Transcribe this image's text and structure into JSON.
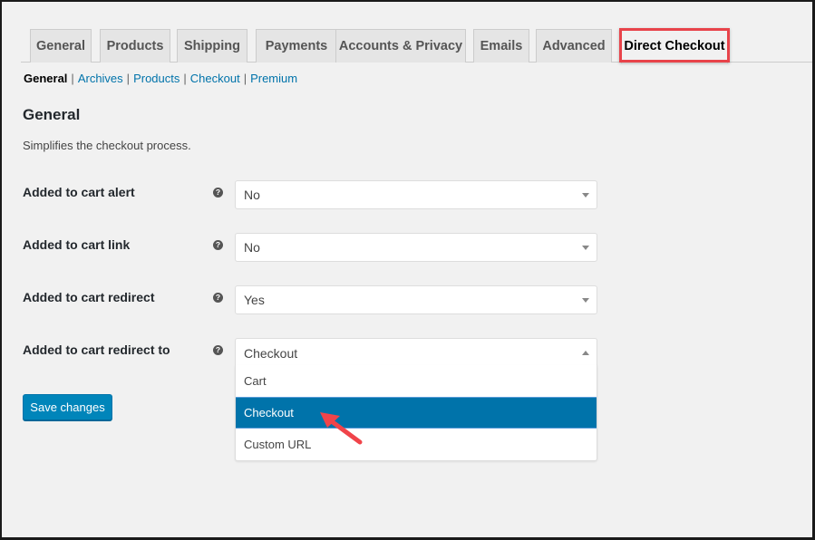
{
  "tabs": [
    {
      "label": "General",
      "active": false
    },
    {
      "label": "Products",
      "active": false
    },
    {
      "label": "Shipping",
      "active": false
    },
    {
      "label": "Payments",
      "active": false
    },
    {
      "label": "Accounts & Privacy",
      "active": false
    },
    {
      "label": "Emails",
      "active": false
    },
    {
      "label": "Advanced",
      "active": false
    },
    {
      "label": "Direct Checkout",
      "active": true
    }
  ],
  "subnav": {
    "current": "General",
    "links": [
      "Archives",
      "Products",
      "Checkout",
      "Premium"
    ],
    "separator": "|"
  },
  "section": {
    "title": "General",
    "description": "Simplifies the checkout process."
  },
  "settings": [
    {
      "label": "Added to cart alert",
      "value": "No",
      "help_icon": "question-circle-icon"
    },
    {
      "label": "Added to cart link",
      "value": "No",
      "help_icon": "question-circle-icon"
    },
    {
      "label": "Added to cart redirect",
      "value": "Yes",
      "help_icon": "question-circle-icon"
    },
    {
      "label": "Added to cart redirect to",
      "value": "Checkout",
      "help_icon": "question-circle-icon",
      "open": true,
      "options": [
        "Cart",
        "Checkout",
        "Custom URL"
      ],
      "highlighted_option": "Checkout"
    }
  ],
  "help_glyph": "?",
  "save_button": {
    "label": "Save changes"
  },
  "colors": {
    "accent": "#0073aa",
    "button": "#0085ba",
    "highlight_box": "#e8434a",
    "annotation_arrow": "#f0444a",
    "background": "#f1f1f1"
  }
}
